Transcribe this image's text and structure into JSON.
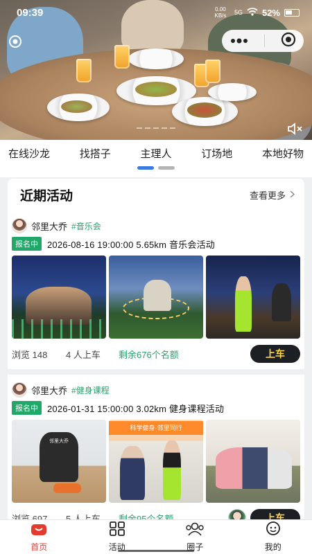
{
  "status": {
    "time": "09:39",
    "net": "0.00 KB/s",
    "signal": "5G",
    "battery": "52%"
  },
  "categories": [
    "在线沙龙",
    "找搭子",
    "主理人",
    "订场地",
    "本地好物"
  ],
  "card": {
    "title": "近期活动",
    "more": "查看更多",
    "activities": [
      {
        "user": "邻里大乔",
        "tag": "#音乐会",
        "status": "报名中",
        "info": "2026-08-16 19:00:00 5.65km 音乐会活动",
        "views": "浏览 148",
        "joined": "4 人上车",
        "remaining": "剩余676个名额",
        "join_label": "上车"
      },
      {
        "user": "邻里大乔",
        "tag": "#健身课程",
        "status": "报名中",
        "info": "2026-01-31 15:00:00 3.02km 健身课程活动",
        "views": "浏览 697",
        "joined": "5 人上车",
        "remaining": "剩余95个名额",
        "join_label": "上车"
      }
    ]
  },
  "image_texts": {
    "bag_brand": "邻里大乔",
    "banner": "科学健身·邻里同行"
  },
  "tabs": [
    {
      "label": "首页",
      "icon": "home-icon",
      "active": true
    },
    {
      "label": "活动",
      "icon": "grid-icon",
      "active": false
    },
    {
      "label": "圈子",
      "icon": "people-icon",
      "active": false
    },
    {
      "label": "我的",
      "icon": "profile-icon",
      "active": false
    }
  ],
  "colors": {
    "accent_green": "#20a868",
    "join_bg": "#1c1f23",
    "join_text": "#ffd54a",
    "active_tab": "#e23b2e",
    "active_dot": "#3a7be0"
  }
}
